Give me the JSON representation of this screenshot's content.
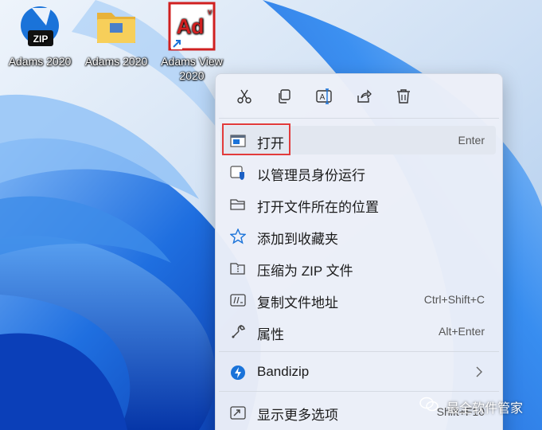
{
  "desktop": {
    "icons": [
      {
        "label": "Adams 2020",
        "icon": "zip-archive-icon"
      },
      {
        "label": "Adams 2020",
        "icon": "folder-icon"
      },
      {
        "label": "Adams View 2020",
        "icon": "adams-view-shortcut-icon",
        "badge": "Ad"
      }
    ]
  },
  "context_menu": {
    "toolbar": [
      {
        "name": "cut",
        "icon": "scissors-icon"
      },
      {
        "name": "copy",
        "icon": "copy-icon"
      },
      {
        "name": "rename",
        "icon": "rename-icon"
      },
      {
        "name": "share",
        "icon": "share-icon"
      },
      {
        "name": "delete",
        "icon": "trash-icon"
      }
    ],
    "items": [
      {
        "label": "打开",
        "shortcut": "Enter",
        "icon": "open-icon"
      },
      {
        "label": "以管理员身份运行",
        "shortcut": "",
        "icon": "shield-icon"
      },
      {
        "label": "打开文件所在的位置",
        "shortcut": "",
        "icon": "folder-open-icon"
      },
      {
        "label": "添加到收藏夹",
        "shortcut": "",
        "icon": "star-icon"
      },
      {
        "label": "压缩为 ZIP 文件",
        "shortcut": "",
        "icon": "zip-folder-icon"
      },
      {
        "label": "复制文件地址",
        "shortcut": "Ctrl+Shift+C",
        "icon": "path-copy-icon"
      },
      {
        "label": "属性",
        "shortcut": "Alt+Enter",
        "icon": "wrench-icon"
      },
      {
        "label": "Bandizip",
        "shortcut": "",
        "icon": "bandizip-icon",
        "submenu": true
      },
      {
        "label": "显示更多选项",
        "shortcut": "Shift+F10",
        "icon": "more-options-icon"
      }
    ]
  },
  "watermark": {
    "text": "最全软件管家"
  },
  "colors": {
    "highlight": "#e23b3b",
    "accent": "#1a73d9"
  }
}
